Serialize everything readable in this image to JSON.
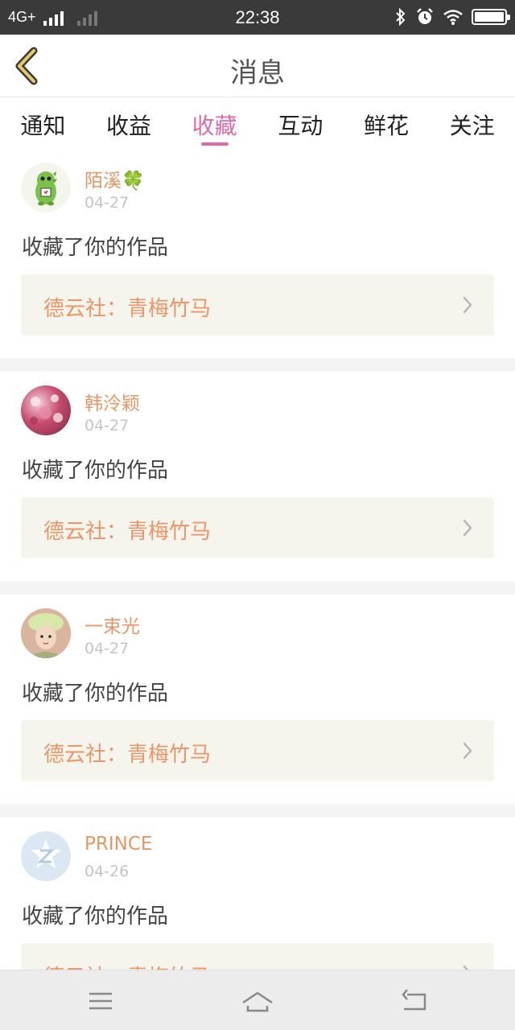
{
  "status_bar": {
    "carrier": "4G+",
    "time": "22:38",
    "icons": [
      "signal-icon",
      "bluetooth-icon",
      "alarm-icon",
      "wifi-icon",
      "battery-icon"
    ]
  },
  "header": {
    "back_icon": "chevron-left-icon",
    "title": "消息"
  },
  "tabs": [
    {
      "label": "通知",
      "active": false
    },
    {
      "label": "收益",
      "active": false
    },
    {
      "label": "收藏",
      "active": true
    },
    {
      "label": "互动",
      "active": false
    },
    {
      "label": "鲜花",
      "active": false
    },
    {
      "label": "关注",
      "active": false
    }
  ],
  "feed": {
    "items": [
      {
        "username": "陌溪🍀",
        "date": "04-27",
        "action": "收藏了你的作品",
        "work_title": "德云社：青梅竹马"
      },
      {
        "username": "韩泠颖",
        "date": "04-27",
        "action": "收藏了你的作品",
        "work_title": "德云社：青梅竹马"
      },
      {
        "username": "一束光",
        "date": "04-27",
        "action": "收藏了你的作品",
        "work_title": "德云社：青梅竹马"
      },
      {
        "username": "PRINCE",
        "date": "04-26",
        "action": "收藏了你的作品",
        "work_title": "德云社：青梅竹马"
      }
    ]
  },
  "colors": {
    "accent": "#e06aa8",
    "username": "#e89666",
    "work_title": "#ec9566",
    "status_bar": "#3a3a3a"
  },
  "nav_bar": {
    "icons": [
      "menu-icon",
      "home-icon",
      "back-icon"
    ]
  }
}
